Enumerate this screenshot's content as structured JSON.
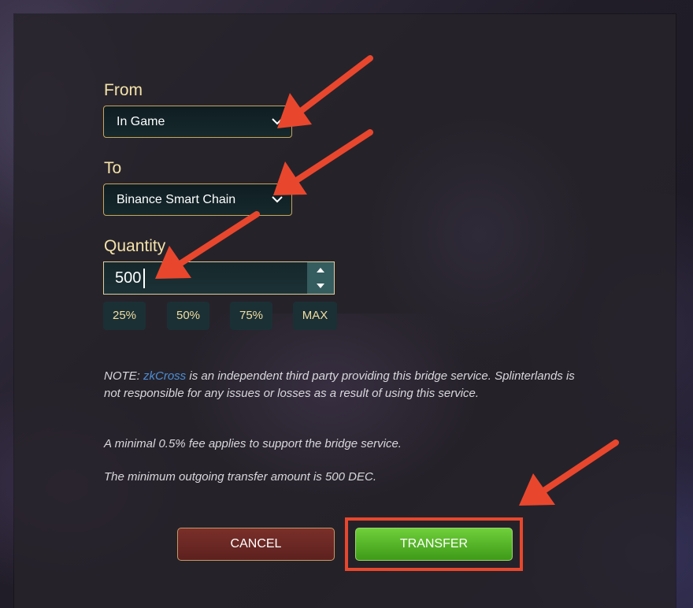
{
  "form": {
    "from": {
      "label": "From",
      "value": "In Game"
    },
    "to": {
      "label": "To",
      "value": "Binance Smart Chain"
    },
    "quantity": {
      "label": "Quantity",
      "value": "500"
    },
    "percent_buttons": [
      "25%",
      "50%",
      "75%",
      "MAX"
    ]
  },
  "notes": {
    "note_prefix": "NOTE: ",
    "link_text": "zkCross",
    "note_rest": " is an independent third party providing this bridge service. Splinterlands is not responsible for any issues or losses as a result of using this service.",
    "fee": "A minimal 0.5% fee applies to support the bridge service.",
    "minimum": "The minimum outgoing transfer amount is 500 DEC."
  },
  "buttons": {
    "cancel": "CANCEL",
    "transfer": "TRANSFER"
  },
  "colors": {
    "label": "#f4e3a8",
    "select_border": "#c9a65a",
    "link": "#4b8fd6",
    "cancel_bg": "#6b2824",
    "transfer_bg": "#56b62a",
    "annotation": "#e8472d"
  },
  "icons": {
    "dropdown": "chevron-down-icon",
    "spin_up": "caret-up-icon",
    "spin_down": "caret-down-icon",
    "annotation": "arrow-icon"
  }
}
